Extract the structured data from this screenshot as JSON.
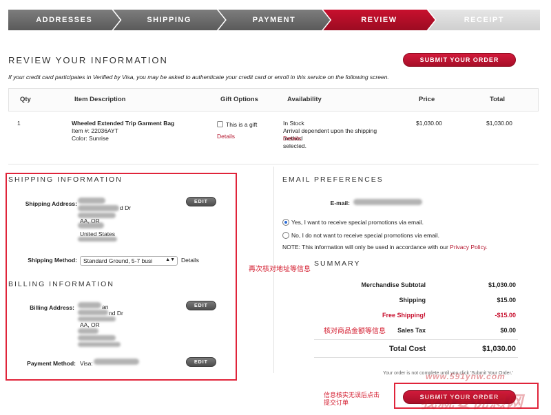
{
  "steps": [
    "ADDRESSES",
    "SHIPPING",
    "PAYMENT",
    "REVIEW",
    "RECEIPT"
  ],
  "page_title": "REVIEW YOUR INFORMATION",
  "submit_label": "SUBMIT YOUR ORDER",
  "verified_note": "If your credit card participates in Verified by Visa, you may be asked to authenticate your credit card or enroll in this service on the following screen.",
  "table": {
    "headers": [
      "Qty",
      "Item Description",
      "Gift Options",
      "Availability",
      "Price",
      "Total"
    ],
    "row": {
      "qty": "1",
      "name": "Wheeled Extended Trip Garment Bag",
      "item_no": "Item #: 22036AYT",
      "color": "Color: Sunrise",
      "gift_label": "This is a gift",
      "gift_details": "Details",
      "stock": "In Stock",
      "avail_line1": "Arrival dependent upon the shipping",
      "avail_line2": "method selected.",
      "avail_details": "Details",
      "price": "$1,030.00",
      "total": "$1,030.00"
    }
  },
  "shipping": {
    "title": "SHIPPING INFORMATION",
    "address_label": "Shipping Address:",
    "address_lines": [
      "d Dr",
      "AA, OR",
      "United States"
    ],
    "edit": "EDIT",
    "method_label": "Shipping Method:",
    "method_value": "Standard Ground, 5-7 busi",
    "method_details": "Details"
  },
  "billing": {
    "title": "BILLING INFORMATION",
    "address_label": "Billing Address:",
    "address_lines": [
      "an",
      "nd Dr",
      "AA, OR"
    ],
    "edit": "EDIT",
    "payment_label": "Payment Method:",
    "payment_value": "Visa:",
    "payment_edit": "EDIT"
  },
  "email": {
    "title": "EMAIL PREFERENCES",
    "label": "E-mail:",
    "opt_yes": "Yes, I want to receive special promotions via email.",
    "opt_no": "No, I do not want to receive special promotions via email.",
    "note": "NOTE: This information will only be used in accordance with our",
    "privacy": "Privacy Policy."
  },
  "summary": {
    "title": "SUMMARY",
    "rows": [
      {
        "label": "Merchandise Subtotal",
        "value": "$1,030.00"
      },
      {
        "label": "Shipping",
        "value": "$15.00"
      },
      {
        "label": "Free Shipping!",
        "value": "-$15.00"
      },
      {
        "label": "Sales Tax",
        "value": "$0.00"
      }
    ],
    "total_label": "Total Cost",
    "total_value": "$1,030.00",
    "not_complete": "Your order is not complete until you click 'Submit Your Order.'"
  },
  "annotations": {
    "recheck_address": "再次核对地址等信息",
    "check_amount": "核对商品金额等信息",
    "confirm_line1": "信息核实无误后点击",
    "confirm_line2": "提交订单"
  },
  "watermark": {
    "url": "www.591ynw.com",
    "brand": "我就要优惠网"
  },
  "colors": {
    "accent": "#c8102e",
    "annotation_red": "#e0243a"
  }
}
